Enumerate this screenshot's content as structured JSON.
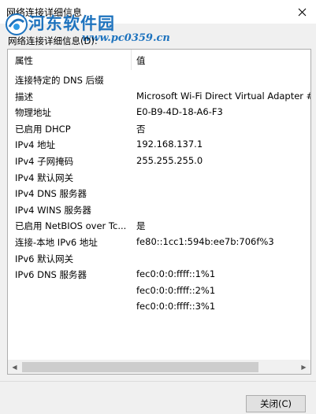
{
  "window": {
    "title": "网络连接详细信息"
  },
  "watermark": {
    "title": "河东软件园",
    "url": "www.pc0359.cn"
  },
  "group": {
    "label": "网络连接详细信息(D):"
  },
  "table": {
    "headers": [
      "属性",
      "值"
    ],
    "rows": [
      {
        "property": "连接特定的 DNS 后缀",
        "value": ""
      },
      {
        "property": "描述",
        "value": "Microsoft Wi-Fi Direct Virtual Adapter #"
      },
      {
        "property": "物理地址",
        "value": "E0-B9-4D-18-A6-F3"
      },
      {
        "property": "已启用 DHCP",
        "value": "否"
      },
      {
        "property": "IPv4 地址",
        "value": "192.168.137.1"
      },
      {
        "property": "IPv4 子网掩码",
        "value": "255.255.255.0"
      },
      {
        "property": "IPv4 默认网关",
        "value": ""
      },
      {
        "property": "IPv4 DNS 服务器",
        "value": ""
      },
      {
        "property": "IPv4 WINS 服务器",
        "value": ""
      },
      {
        "property": "已启用 NetBIOS over Tc...",
        "value": "是"
      },
      {
        "property": "连接-本地 IPv6 地址",
        "value": "fe80::1cc1:594b:ee7b:706f%3"
      },
      {
        "property": "IPv6 默认网关",
        "value": ""
      },
      {
        "property": "IPv6 DNS 服务器",
        "value": "fec0:0:0:ffff::1%1"
      },
      {
        "property": "",
        "value": "fec0:0:0:ffff::2%1"
      },
      {
        "property": "",
        "value": "fec0:0:0:ffff::3%1"
      }
    ]
  },
  "buttons": {
    "close_label": "关闭(C)"
  },
  "icons": {
    "close": "close-icon",
    "scroll_left": "scroll-left-arrow-icon",
    "scroll_right": "scroll-right-arrow-icon"
  }
}
